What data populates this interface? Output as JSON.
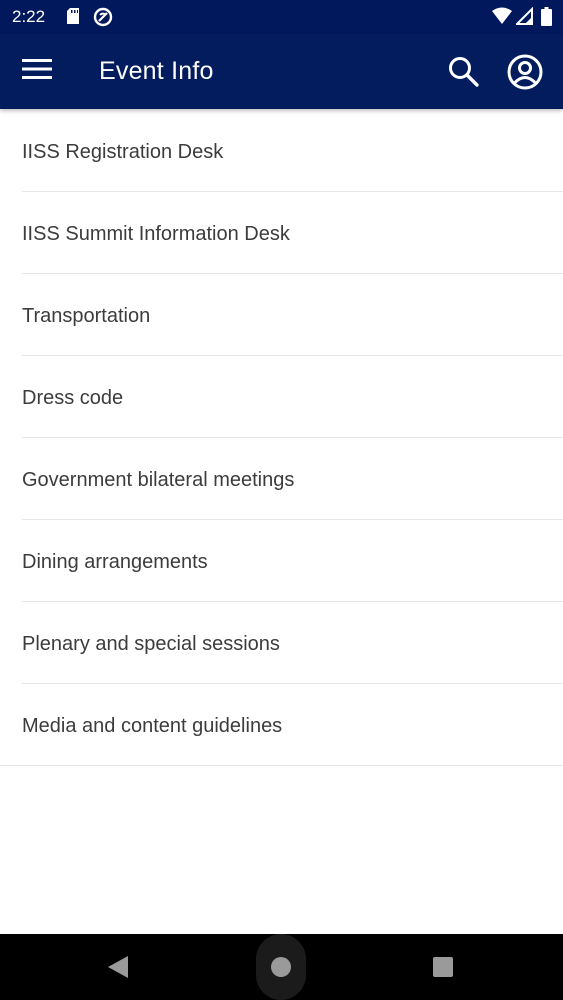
{
  "status_bar": {
    "time": "2:22",
    "icons": [
      "sd-card-icon",
      "no-interruptions-icon",
      "wifi-icon",
      "cellular-signal-icon",
      "battery-icon"
    ]
  },
  "app_bar": {
    "title": "Event Info",
    "icons": [
      "menu-icon",
      "search-icon",
      "account-icon"
    ],
    "background_color": "#021c5e"
  },
  "list": {
    "items": [
      {
        "label": "IISS Registration Desk"
      },
      {
        "label": "IISS Summit Information Desk"
      },
      {
        "label": "Transportation"
      },
      {
        "label": "Dress code"
      },
      {
        "label": "Government bilateral meetings"
      },
      {
        "label": "Dining arrangements"
      },
      {
        "label": "Plenary and special sessions"
      },
      {
        "label": "Media and content guidelines"
      }
    ]
  },
  "nav_bar": {
    "icons": [
      "back-icon",
      "home-icon",
      "recents-icon"
    ]
  }
}
